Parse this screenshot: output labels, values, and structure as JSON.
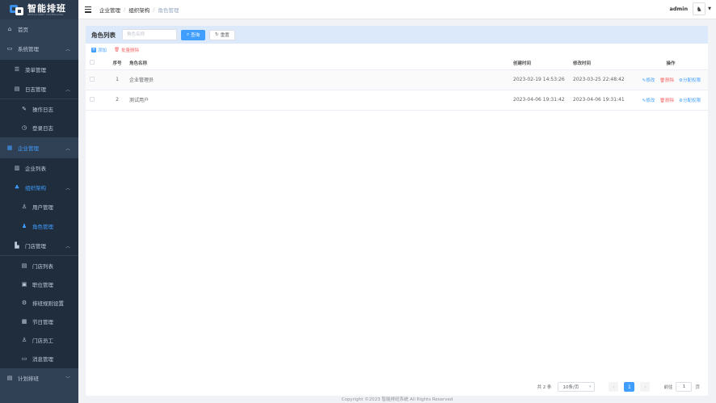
{
  "logo": {
    "title": "智能排班",
    "subtitle": "INTELLIGENT SCHEDULING"
  },
  "sidebar": {
    "items": [
      {
        "label": "首页",
        "icon": "home-icon"
      },
      {
        "label": "系统管理",
        "icon": "monitor-icon"
      },
      {
        "label": "菜单管理",
        "icon": "menu-icon"
      },
      {
        "label": "日志管理",
        "icon": "log-icon"
      },
      {
        "label": "操作日志",
        "icon": "wrench-icon"
      },
      {
        "label": "登录日志",
        "icon": "clock-icon"
      },
      {
        "label": "企业管理",
        "icon": "enterprise-icon"
      },
      {
        "label": "企业列表",
        "icon": "building-icon"
      },
      {
        "label": "组织架构",
        "icon": "org-icon"
      },
      {
        "label": "用户管理",
        "icon": "user-icon"
      },
      {
        "label": "角色管理",
        "icon": "role-icon"
      },
      {
        "label": "门店管理",
        "icon": "store-icon"
      },
      {
        "label": "门店列表",
        "icon": "list-icon"
      },
      {
        "label": "职位管理",
        "icon": "position-icon"
      },
      {
        "label": "排班规则设置",
        "icon": "rule-settings-icon"
      },
      {
        "label": "节日管理",
        "icon": "calendar-icon"
      },
      {
        "label": "门店员工",
        "icon": "staff-icon"
      },
      {
        "label": "消息管理",
        "icon": "message-icon"
      },
      {
        "label": "计划排班",
        "icon": "schedule-icon"
      }
    ]
  },
  "header": {
    "breadcrumb": [
      "企业管理",
      "组织架构",
      "角色管理"
    ],
    "username": "admin"
  },
  "search": {
    "label": "角色列表",
    "placeholder": "角色名称",
    "query_label": "查询",
    "reset_label": "重置"
  },
  "toolbar": {
    "add_label": "添加",
    "batch_delete_label": "批量删除"
  },
  "table": {
    "headers": [
      "序号",
      "角色名称",
      "创建时间",
      "修改时间",
      "操作"
    ],
    "rows": [
      {
        "index": "1",
        "name": "企业管理员",
        "created": "2023-02-19 14:53:26",
        "modified": "2023-03-25 22:48:42"
      },
      {
        "index": "2",
        "name": "测试用户",
        "created": "2023-04-06 19:31:42",
        "modified": "2023-04-06 19:31:41"
      }
    ],
    "actions": {
      "edit": "修改",
      "delete": "删除",
      "permission": "分配权限"
    }
  },
  "pagination": {
    "total": "共 2 条",
    "page_size": "10条/页",
    "current": "1",
    "goto_label": "前往",
    "goto_value": "1",
    "page_suffix": "页"
  },
  "footer": "Copyright ©2023 智能排班系统 All Rights Reserved",
  "colors": {
    "primary": "#409eff",
    "danger": "#f56c6c",
    "sidebar": "#304156"
  }
}
